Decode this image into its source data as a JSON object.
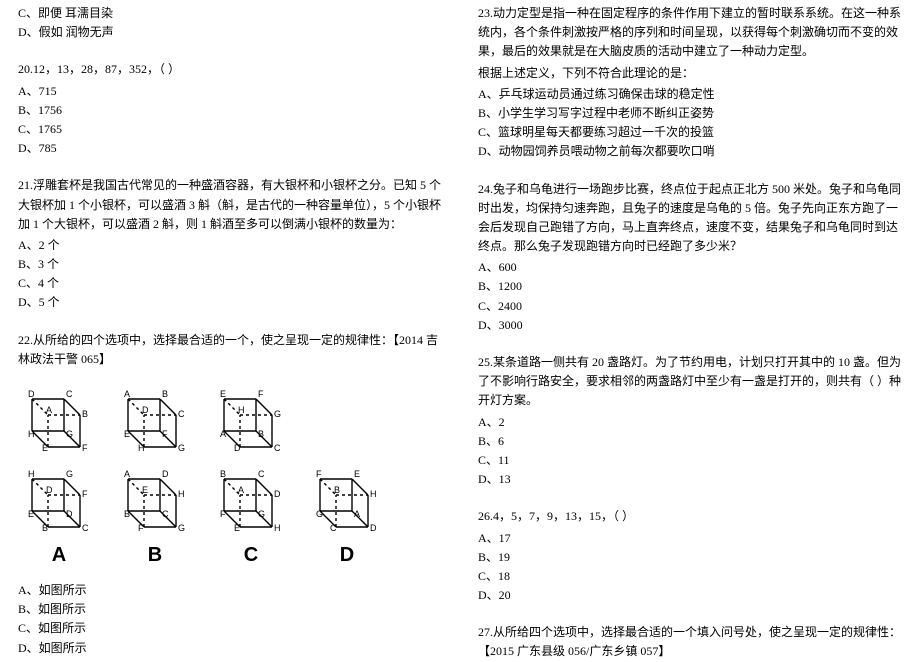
{
  "left": {
    "q19_partial": {
      "optC": "C、即便        耳濡目染",
      "optD": "D、假如        润物无声"
    },
    "q20": {
      "stem": "20.12，13，28，87，352，（    ）",
      "optA": "A、715",
      "optB": "B、1756",
      "optC": "C、1765",
      "optD": "D、785"
    },
    "q21": {
      "stem": "21.浮雕套杯是我国古代常见的一种盛酒容器，有大银杯和小银杯之分。已知 5 个大银杯加 1 个小银杯，可以盛酒 3 斛（斛，是古代的一种容量单位），5 个小银杯加 1 个大银杯，可以盛酒 2 斛，则 1 斛酒至多可以倒满小银杯的数量为：",
      "optA": "A、2 个",
      "optB": "B、3 个",
      "optC": "C、4 个",
      "optD": "D、5 个"
    },
    "q22": {
      "stem": "22.从所给的四个选项中，选择最合适的一个，使之呈现一定的规律性：【2014 吉林政法干警 065】",
      "optA": "A、如图所示",
      "optB": "B、如图所示",
      "optC": "C、如图所示",
      "optD": "D、如图所示",
      "labelA": "A",
      "labelB": "B",
      "labelC": "C",
      "labelD": "D"
    }
  },
  "right": {
    "q23": {
      "stem": "23.动力定型是指一种在固定程序的条件作用下建立的暂时联系系统。在这一种系统内，各个条件刺激按严格的序列和时间呈现，以获得每个刺激确切而不变的效果，最后的效果就是在大脑皮质的活动中建立了一种动力定型。",
      "sub": "根据上述定义，下列不符合此理论的是：",
      "optA": "A、乒乓球运动员通过练习确保击球的稳定性",
      "optB": "B、小学生学习写字过程中老师不断纠正姿势",
      "optC": "C、篮球明星每天都要练习超过一千次的投篮",
      "optD": "D、动物园饲养员喂动物之前每次都要吹口哨"
    },
    "q24": {
      "stem": "24.兔子和乌龟进行一场跑步比赛，终点位于起点正北方 500 米处。兔子和乌龟同时出发，均保持匀速奔跑，且兔子的速度是乌龟的 5 倍。兔子先向正东方跑了一会后发现自己跑错了方向，马上直奔终点，速度不变，结果兔子和乌龟同时到达终点。那么兔子发现跑错方向时已经跑了多少米？",
      "optA": "A、600",
      "optB": "B、1200",
      "optC": "C、2400",
      "optD": "D、3000"
    },
    "q25": {
      "stem": "25.某条道路一侧共有 20 盏路灯。为了节约用电，计划只打开其中的 10 盏。但为了不影响行路安全，要求相邻的两盏路灯中至少有一盏是打开的，则共有（   ）种开灯方案。",
      "optA": "A、2",
      "optB": "B、6",
      "optC": "C、11",
      "optD": "D、13"
    },
    "q26": {
      "stem": "26.4，5，7，9，13，15，（     ）",
      "optA": "A、17",
      "optB": "B、19",
      "optC": "C、18",
      "optD": "D、20"
    },
    "q27": {
      "stem": "27.从所给四个选项中，选择最合适的一个填入问号处，使之呈现一定的规律性：【2015 广东县级 056/广东乡镇 057】"
    }
  }
}
